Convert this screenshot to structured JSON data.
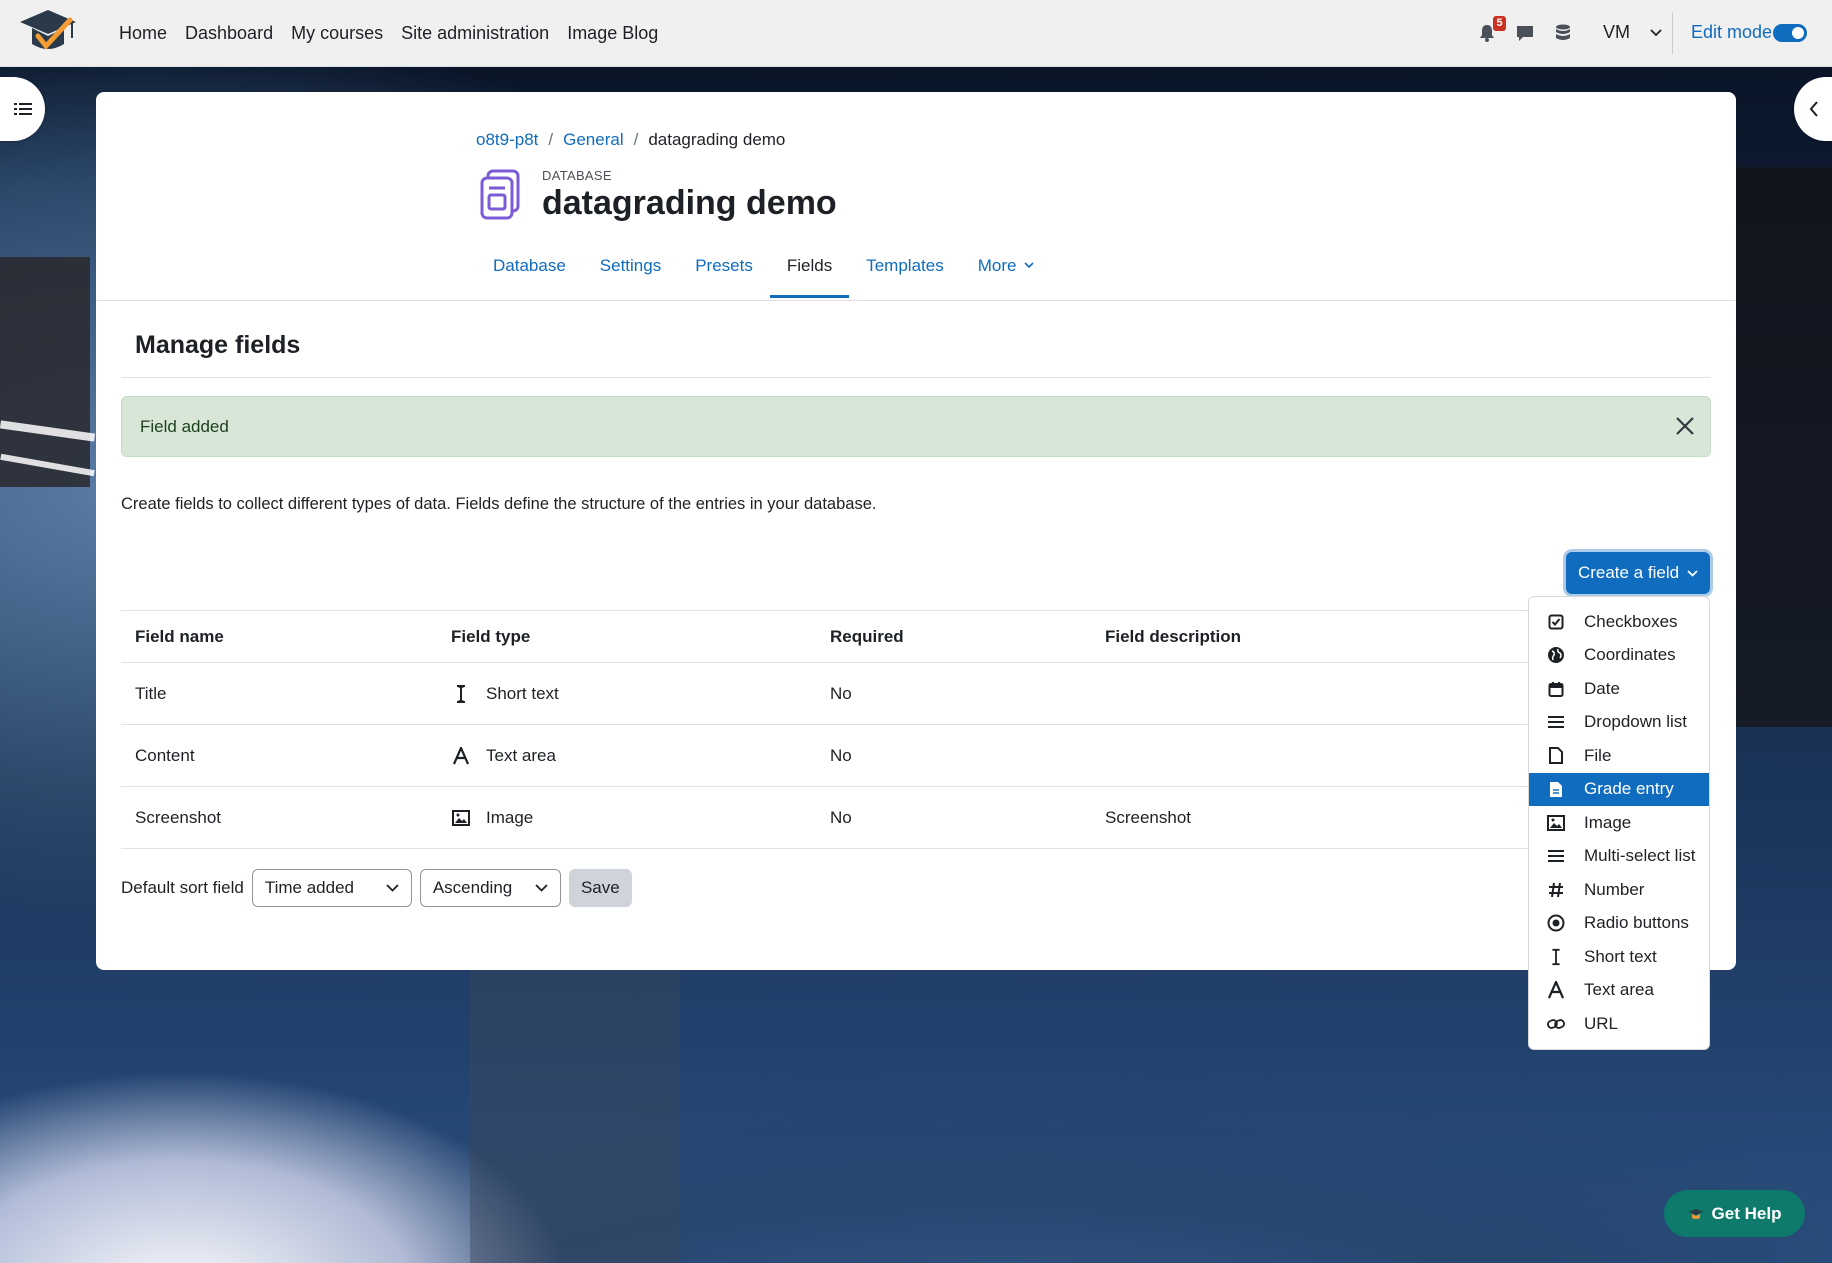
{
  "navbar": {
    "primary": [
      "Home",
      "Dashboard",
      "My courses",
      "Site administration",
      "Image Blog"
    ],
    "notification_count": "5",
    "user_initials": "VM",
    "edit_mode_label": "Edit mode"
  },
  "breadcrumb": [
    "o8t9-p8t",
    "General",
    "datagrading demo"
  ],
  "activity": {
    "type": "DATABASE",
    "title": "datagrading demo"
  },
  "tabs": [
    "Database",
    "Settings",
    "Presets",
    "Fields",
    "Templates",
    "More"
  ],
  "active_tab": "Fields",
  "page_heading": "Manage fields",
  "alert": "Field added",
  "intro": "Create fields to collect different types of data. Fields define the structure of the entries in your database.",
  "create_button": "Create a field",
  "table": {
    "headers": [
      "Field name",
      "Field type",
      "Required",
      "Field description"
    ],
    "rows": [
      {
        "name": "Title",
        "type": "Short text",
        "required": "No",
        "description": ""
      },
      {
        "name": "Content",
        "type": "Text area",
        "required": "No",
        "description": ""
      },
      {
        "name": "Screenshot",
        "type": "Image",
        "required": "No",
        "description": "Screenshot"
      }
    ]
  },
  "sort": {
    "label": "Default sort field",
    "field": "Time added",
    "order": "Ascending",
    "save": "Save"
  },
  "dropdown": {
    "items": [
      "Checkboxes",
      "Coordinates",
      "Date",
      "Dropdown list",
      "File",
      "Grade entry",
      "Image",
      "Multi-select list",
      "Number",
      "Radio buttons",
      "Short text",
      "Text area",
      "URL"
    ],
    "highlighted": "Grade entry"
  },
  "help_button": "Get Help",
  "colors": {
    "primary": "#0f6cbf",
    "alert_bg": "#d7e6d7",
    "help": "#0d7a6b"
  }
}
